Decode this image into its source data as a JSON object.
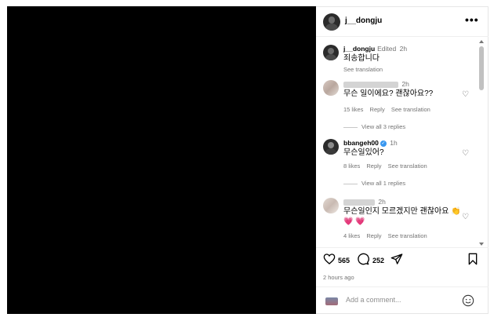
{
  "post": {
    "username": "j__dongju",
    "more_label": "•••"
  },
  "caption": {
    "username": "j__dongju",
    "edited": "Edited",
    "time": "2h",
    "text": "죄송합니다",
    "translation": "See translation"
  },
  "comments": [
    {
      "time": "2h",
      "text": "무슨 일이에요? 괜찮아요??",
      "likes": "15 likes",
      "reply": "Reply",
      "translation": "See translation",
      "view_replies": "View all 3 replies"
    },
    {
      "username": "bbangeh00",
      "time": "1h",
      "text": "무슨일있어?",
      "likes": "8 likes",
      "reply": "Reply",
      "translation": "See translation",
      "view_replies": "View all 1 replies"
    },
    {
      "time": "2h",
      "text": "무슨일인지 모르겠지만 괜찮아요 👏 💗 💗",
      "likes": "4 likes",
      "reply": "Reply",
      "translation": "See translation"
    }
  ],
  "stats": {
    "likes": "565",
    "comments": "252",
    "time_ago": "2 hours ago"
  },
  "add_comment": {
    "placeholder": "Add a comment..."
  },
  "icons": [
    "heart-icon",
    "comment-icon",
    "share-icon",
    "bookmark-icon",
    "emoji-icon",
    "more-icon",
    "verified-icon"
  ],
  "colors": {
    "media_background": "#000000",
    "muted_text": "#737373",
    "verified": "#3897f0"
  }
}
